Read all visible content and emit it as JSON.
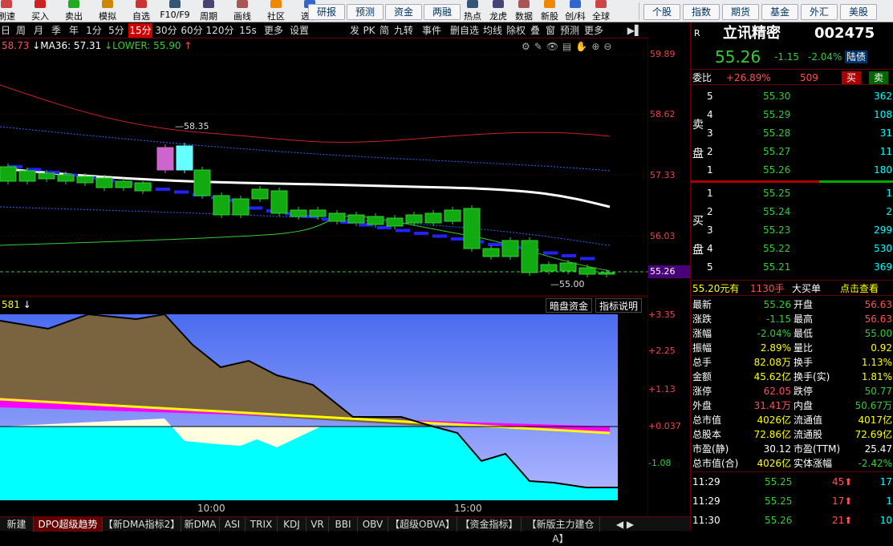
{
  "toolbar": {
    "left_buttons": [
      "刷速",
      "买入",
      "卖出",
      "模拟",
      "自选",
      "F10/F9",
      "周期",
      "画线",
      "社区",
      "选股"
    ],
    "pills": [
      "研报",
      "预测",
      "资金",
      "两融"
    ],
    "mid_buttons": [
      "热点",
      "龙虎",
      "数据",
      "新股",
      "创/科",
      "全球"
    ],
    "right_pills": [
      "个股",
      "指数",
      "期货",
      "基金",
      "外汇",
      "美股"
    ]
  },
  "periods": [
    "日",
    "周",
    "月",
    "季",
    "年",
    "1分",
    "5分",
    "15分",
    "30分",
    "60分",
    "120分",
    "15s",
    "更多",
    "设置"
  ],
  "active_period": "15分",
  "period_right": [
    "发",
    "PK",
    "简",
    "九转",
    "事件",
    "删自选",
    "均线",
    "除权",
    "叠",
    "窗",
    "预测",
    "更多"
  ],
  "main_indicator": {
    "text1": "58.73",
    "ma36": "↓MA36: 57.31",
    "lower": "↓LOWER: 55.90",
    "up_arrow": "↑"
  },
  "price_axis": [
    "59.89",
    "58.62",
    "57.33",
    "56.03",
    "55.26"
  ],
  "high_label": "58.35",
  "low_label": "55.00",
  "sub_indicator": {
    "value": "581",
    "arrow": "↓",
    "btn1": "暗盘资金",
    "btn2": "指标说明"
  },
  "sub_axis": [
    "+3.35",
    "+2.25",
    "+1.13",
    "+0.037",
    "-1.08"
  ],
  "time_labels": [
    "10:00",
    "15:00"
  ],
  "stock": {
    "mark": "R",
    "name": "立讯精密",
    "code": "002475",
    "price": "55.26",
    "change": "-1.15",
    "pct": "-2.04%",
    "badge": "陆债"
  },
  "weibi": {
    "label": "委比",
    "pct": "+26.89%",
    "diff": "509",
    "buy": "买",
    "sell": "卖"
  },
  "sell_side_label": [
    "卖",
    "盘"
  ],
  "buy_side_label": [
    "买",
    "盘"
  ],
  "sells": [
    {
      "lv": "5",
      "price": "55.30",
      "vol": "362"
    },
    {
      "lv": "4",
      "price": "55.29",
      "vol": "108"
    },
    {
      "lv": "3",
      "price": "55.28",
      "vol": "31"
    },
    {
      "lv": "2",
      "price": "55.27",
      "vol": "11"
    },
    {
      "lv": "1",
      "price": "55.26",
      "vol": "180"
    }
  ],
  "buys": [
    {
      "lv": "1",
      "price": "55.25",
      "vol": "1"
    },
    {
      "lv": "2",
      "price": "55.24",
      "vol": "2"
    },
    {
      "lv": "3",
      "price": "55.23",
      "vol": "299"
    },
    {
      "lv": "4",
      "price": "55.22",
      "vol": "530"
    },
    {
      "lv": "5",
      "price": "55.21",
      "vol": "369"
    }
  ],
  "bigorder": {
    "price": "55.20元有",
    "vol": "1130手",
    "label": "大买单",
    "link": "点击查看"
  },
  "stats": [
    {
      "k1": "最新",
      "v1": "55.26",
      "c1": "green",
      "k2": "开盘",
      "v2": "56.63",
      "c2": "red"
    },
    {
      "k1": "涨跌",
      "v1": "-1.15",
      "c1": "green",
      "k2": "最高",
      "v2": "56.63",
      "c2": "red"
    },
    {
      "k1": "涨幅",
      "v1": "-2.04%",
      "c1": "green",
      "k2": "最低",
      "v2": "55.00",
      "c2": "green"
    },
    {
      "k1": "振幅",
      "v1": "2.89%",
      "c1": "yellow",
      "k2": "量比",
      "v2": "0.92",
      "c2": "yellow"
    },
    {
      "k1": "总手",
      "v1": "82.08万",
      "c1": "yellow",
      "k2": "换手",
      "v2": "1.13%",
      "c2": "yellow"
    },
    {
      "k1": "金额",
      "v1": "45.62亿",
      "c1": "yellow",
      "k2": "换手(实)",
      "v2": "1.81%",
      "c2": "yellow"
    },
    {
      "k1": "涨停",
      "v1": "62.05",
      "c1": "red",
      "k2": "跌停",
      "v2": "50.77",
      "c2": "green"
    },
    {
      "k1": "外盘",
      "v1": "31.41万",
      "c1": "red",
      "k2": "内盘",
      "v2": "50.67万",
      "c2": "green"
    },
    {
      "k1": "总市值",
      "v1": "4026亿",
      "c1": "yellow",
      "k2": "流通值",
      "v2": "4017亿",
      "c2": "yellow"
    },
    {
      "k1": "总股本",
      "v1": "72.86亿",
      "c1": "yellow",
      "k2": "流通股",
      "v2": "72.69亿",
      "c2": "yellow"
    },
    {
      "k1": "市盈(静)",
      "v1": "30.12",
      "c1": "white",
      "k2": "市盈(TTM)",
      "v2": "25.47",
      "c2": "white"
    },
    {
      "k1": "总市值(合)",
      "v1": "4026亿",
      "c1": "yellow",
      "k2": "实体涨幅",
      "v2": "-2.42%",
      "c2": "green"
    }
  ],
  "ticks": [
    {
      "time": "11:29",
      "price": "55.25",
      "vol": "45",
      "n": "17"
    },
    {
      "time": "11:29",
      "price": "55.25",
      "vol": "17",
      "n": "1"
    },
    {
      "time": "11:30",
      "price": "55.26",
      "vol": "21",
      "n": "10"
    }
  ],
  "tabs": [
    "新建",
    "DPO超级趋势",
    "【新DMA指标2】",
    "新DMA",
    "ASI",
    "TRIX",
    "KDJ",
    "VR",
    "BBI",
    "OBV",
    "【超级OBVA】",
    "【资金指标】",
    "【新版主力建仓A】"
  ],
  "colors": {
    "up": "#ff5050",
    "down": "#33cc33",
    "active_tab": "#660000"
  }
}
